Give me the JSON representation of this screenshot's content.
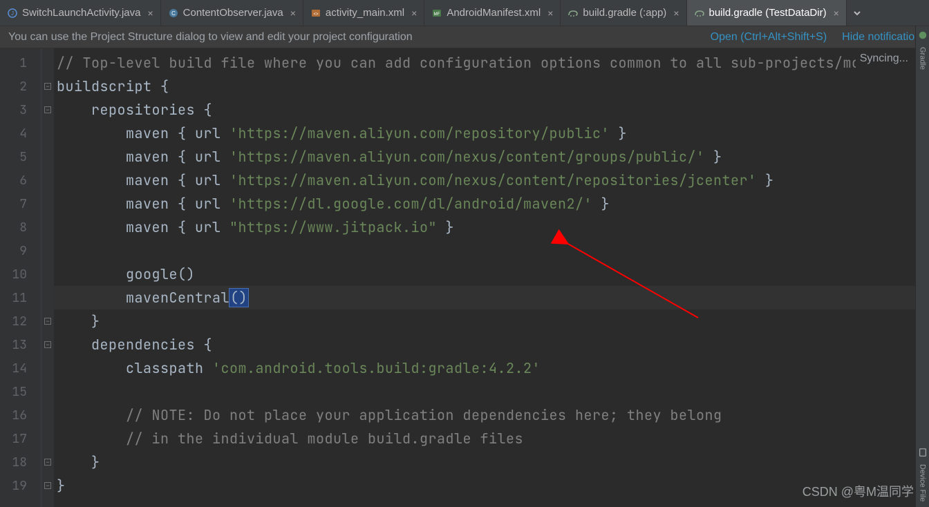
{
  "tabs": [
    {
      "label": "SwitchLaunchActivity.java",
      "icon": "java-icon",
      "active": false
    },
    {
      "label": "ContentObserver.java",
      "icon": "class-icon",
      "active": false
    },
    {
      "label": "activity_main.xml",
      "icon": "xml-icon",
      "active": false
    },
    {
      "label": "AndroidManifest.xml",
      "icon": "manifest-icon",
      "active": false
    },
    {
      "label": "build.gradle (:app)",
      "icon": "gradle-icon",
      "active": false
    },
    {
      "label": "build.gradle (TestDataDir)",
      "icon": "gradle-icon",
      "active": true
    }
  ],
  "notification": {
    "message": "You can use the Project Structure dialog to view and edit your project configuration",
    "open_label": "Open (Ctrl+Alt+Shift+S)",
    "hide_label": "Hide notification"
  },
  "status": {
    "syncing": "Syncing..."
  },
  "code": {
    "lines": [
      {
        "n": 1,
        "fold": "",
        "segs": [
          {
            "t": "// Top-level build file where you can add configuration options common to all sub-projects/modul",
            "c": "cm"
          }
        ]
      },
      {
        "n": 2,
        "fold": "open",
        "segs": [
          {
            "t": "buildscript ",
            "c": "kw"
          },
          {
            "t": "{",
            "c": "punc"
          }
        ]
      },
      {
        "n": 3,
        "fold": "open",
        "segs": [
          {
            "t": "    repositories ",
            "c": "kw"
          },
          {
            "t": "{",
            "c": "punc"
          }
        ]
      },
      {
        "n": 4,
        "fold": "",
        "segs": [
          {
            "t": "        maven ",
            "c": "fn"
          },
          {
            "t": "{ ",
            "c": "punc"
          },
          {
            "t": "url ",
            "c": "kw"
          },
          {
            "t": "'https://maven.aliyun.com/repository/public'",
            "c": "str"
          },
          {
            "t": " }",
            "c": "punc"
          }
        ]
      },
      {
        "n": 5,
        "fold": "",
        "segs": [
          {
            "t": "        maven ",
            "c": "fn"
          },
          {
            "t": "{ ",
            "c": "punc"
          },
          {
            "t": "url ",
            "c": "kw"
          },
          {
            "t": "'https://maven.aliyun.com/nexus/content/groups/public/'",
            "c": "str"
          },
          {
            "t": " }",
            "c": "punc"
          }
        ]
      },
      {
        "n": 6,
        "fold": "",
        "segs": [
          {
            "t": "        maven ",
            "c": "fn"
          },
          {
            "t": "{ ",
            "c": "punc"
          },
          {
            "t": "url ",
            "c": "kw"
          },
          {
            "t": "'https://maven.aliyun.com/nexus/content/repositories/jcenter'",
            "c": "str"
          },
          {
            "t": " }",
            "c": "punc"
          }
        ]
      },
      {
        "n": 7,
        "fold": "",
        "segs": [
          {
            "t": "        maven ",
            "c": "fn"
          },
          {
            "t": "{ ",
            "c": "punc"
          },
          {
            "t": "url ",
            "c": "kw"
          },
          {
            "t": "'https://dl.google.com/dl/android/maven2/'",
            "c": "str"
          },
          {
            "t": " }",
            "c": "punc"
          }
        ]
      },
      {
        "n": 8,
        "fold": "",
        "segs": [
          {
            "t": "        maven ",
            "c": "fn"
          },
          {
            "t": "{ ",
            "c": "punc"
          },
          {
            "t": "url ",
            "c": "kw"
          },
          {
            "t": "\"https://www.jitpack.io\"",
            "c": "str"
          },
          {
            "t": " }",
            "c": "punc"
          }
        ]
      },
      {
        "n": 9,
        "fold": "",
        "segs": [
          {
            "t": "",
            "c": ""
          }
        ]
      },
      {
        "n": 10,
        "fold": "",
        "segs": [
          {
            "t": "        google",
            "c": "fn"
          },
          {
            "t": "()",
            "c": "punc"
          }
        ]
      },
      {
        "n": 11,
        "fold": "",
        "hl": true,
        "segs": [
          {
            "t": "        mavenCentral",
            "c": "fn"
          }
        ],
        "caret_tail": "()"
      },
      {
        "n": 12,
        "fold": "close",
        "segs": [
          {
            "t": "    }",
            "c": "punc"
          }
        ]
      },
      {
        "n": 13,
        "fold": "open",
        "segs": [
          {
            "t": "    dependencies ",
            "c": "kw"
          },
          {
            "t": "{",
            "c": "punc"
          }
        ]
      },
      {
        "n": 14,
        "fold": "",
        "segs": [
          {
            "t": "        classpath ",
            "c": "kw"
          },
          {
            "t": "'com.android.tools.build:gradle:4.2.2'",
            "c": "str"
          }
        ]
      },
      {
        "n": 15,
        "fold": "",
        "segs": [
          {
            "t": "",
            "c": ""
          }
        ]
      },
      {
        "n": 16,
        "fold": "",
        "segs": [
          {
            "t": "        // NOTE: Do not place your application dependencies here; they belong",
            "c": "cm"
          }
        ]
      },
      {
        "n": 17,
        "fold": "",
        "segs": [
          {
            "t": "        // in the individual module build.gradle files",
            "c": "cm"
          }
        ]
      },
      {
        "n": 18,
        "fold": "close",
        "segs": [
          {
            "t": "    }",
            "c": "punc"
          }
        ]
      },
      {
        "n": 19,
        "fold": "close",
        "segs": [
          {
            "t": "}",
            "c": "punc"
          }
        ]
      }
    ]
  },
  "right_rail": {
    "gradle_label": "Gradle",
    "device_label": "Device File"
  },
  "watermark": "CSDN @粤M温同学"
}
